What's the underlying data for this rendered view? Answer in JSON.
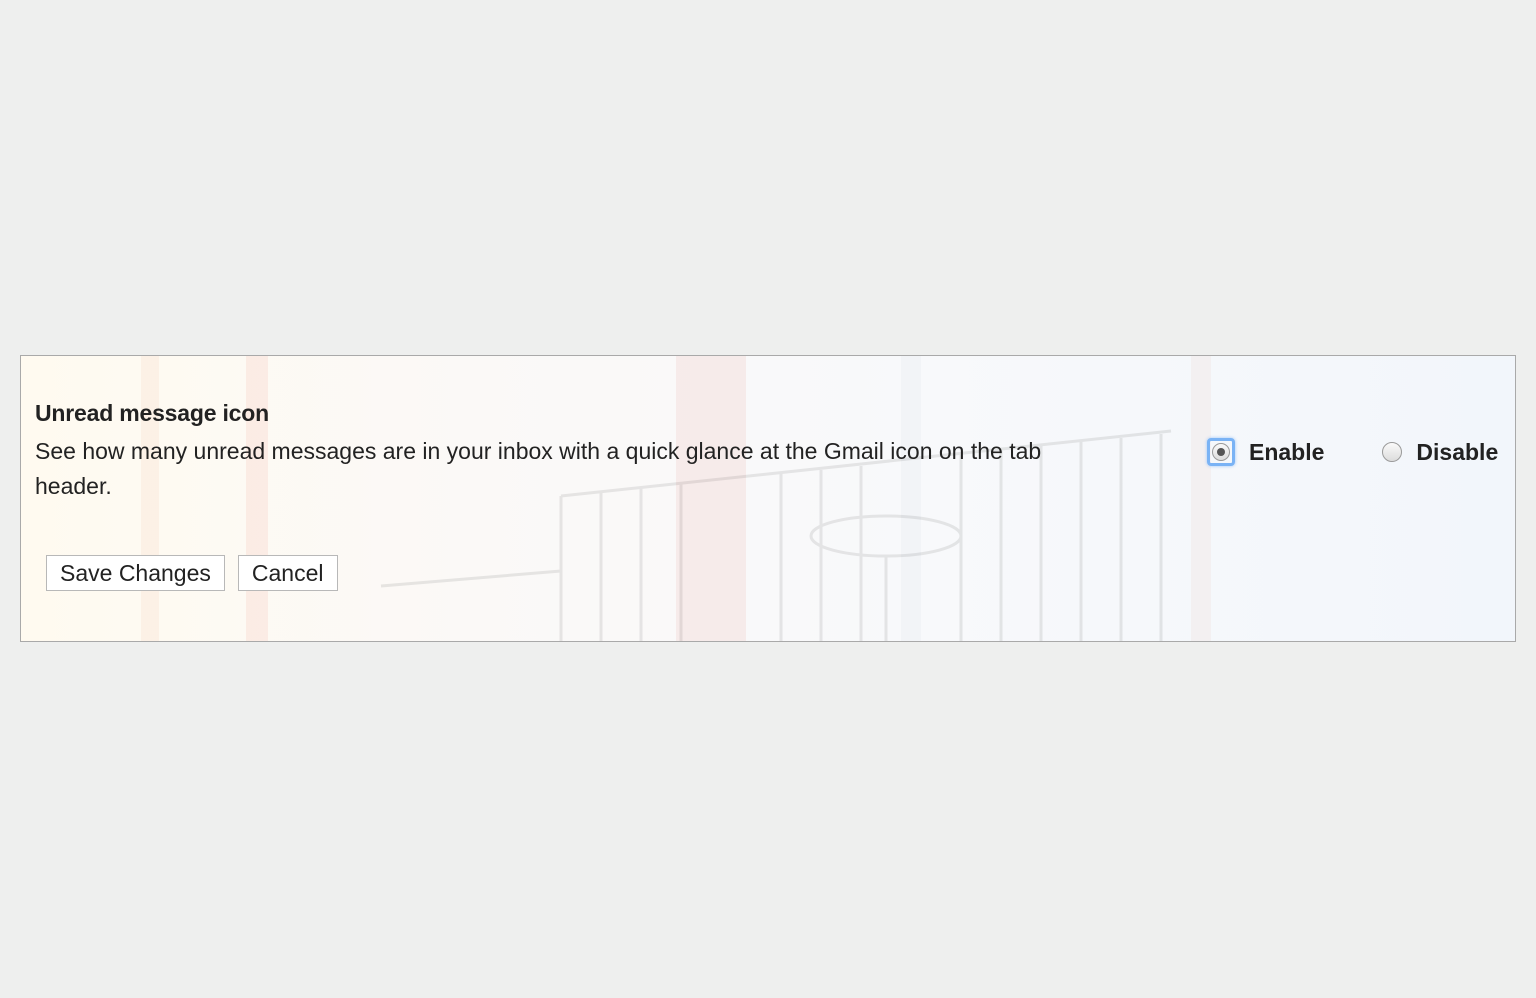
{
  "setting": {
    "title": "Unread message icon",
    "description": "See how many unread messages are in your inbox with a quick glance at the Gmail icon on the tab header."
  },
  "options": {
    "enable": {
      "label": "Enable",
      "selected": true
    },
    "disable": {
      "label": "Disable",
      "selected": false
    }
  },
  "actions": {
    "save_label": "Save Changes",
    "cancel_label": "Cancel"
  },
  "colors": {
    "page_background": "#eeefee",
    "focus_ring": "#7ab3f5",
    "text": "#222222",
    "panel_border": "#a9a9a9"
  }
}
